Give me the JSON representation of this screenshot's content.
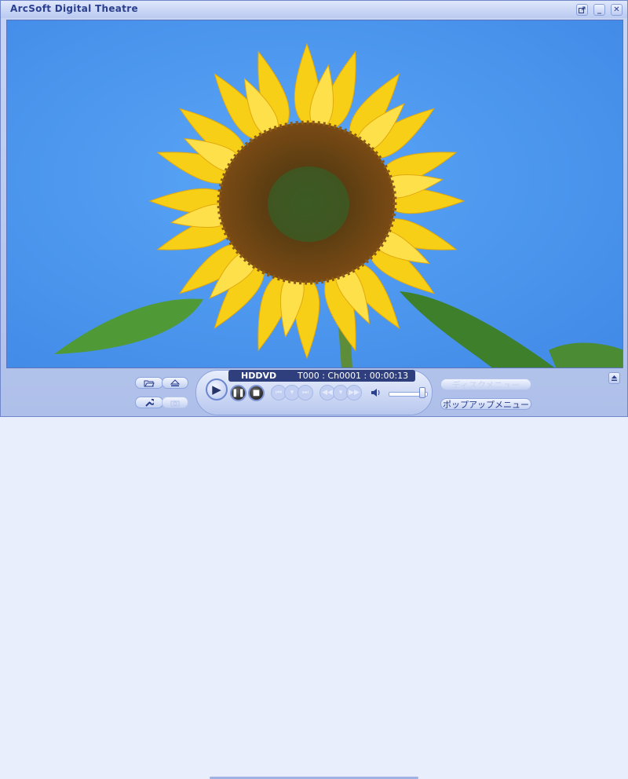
{
  "window": {
    "title": "ArcSoft Digital Theatre",
    "buttons": {
      "restore_icon": "external-link-icon",
      "minimize": "_",
      "close": "✕"
    }
  },
  "video": {
    "description_icon": "sunflower-video-frame"
  },
  "display": {
    "source": "HDDVD",
    "title_chapter_time": "T000 : Ch0001 : 00:00:13"
  },
  "left_buttons": {
    "open_icon": "folder-open-icon",
    "eject_icon": "eject-icon",
    "settings_icon": "wrench-icon",
    "snapshot_icon": "camera-icon"
  },
  "transport": {
    "play_icon": "play-icon",
    "pause_icon": "pause-icon",
    "stop_icon": "stop-icon"
  },
  "menus": {
    "disc_menu": "ディスクメニュー",
    "popup_menu": "ポップアップメニュー"
  },
  "volume": {
    "level": 0.9
  },
  "colors": {
    "sky": "#4c98ef",
    "accent": "#2b3f8f"
  }
}
